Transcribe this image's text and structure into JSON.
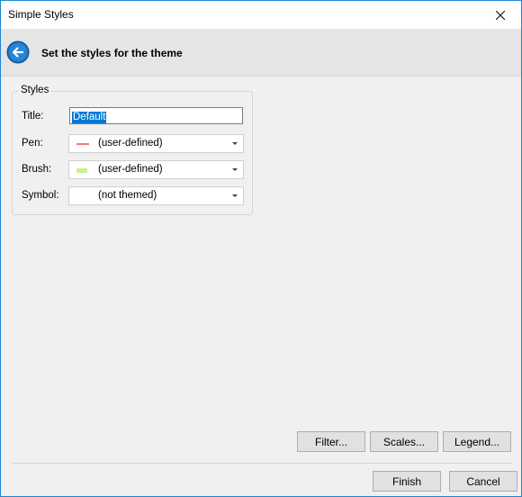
{
  "window": {
    "title": "Simple Styles"
  },
  "header": {
    "title": "Set the styles for the theme"
  },
  "styles_group": {
    "legend": "Styles",
    "title_label": "Title:",
    "title_value": "Default",
    "pen_label": "Pen:",
    "pen_value": "(user-defined)",
    "pen_color": "#f07c7c",
    "brush_label": "Brush:",
    "brush_value": "(user-defined)",
    "brush_color": "#c7f28c",
    "symbol_label": "Symbol:",
    "symbol_value": "(not themed)"
  },
  "buttons": {
    "filter": "Filter...",
    "scales": "Scales...",
    "legend": "Legend...",
    "finish": "Finish",
    "cancel": "Cancel"
  },
  "colors": {
    "accent": "#1e86d1",
    "selection": "#0078d7"
  }
}
